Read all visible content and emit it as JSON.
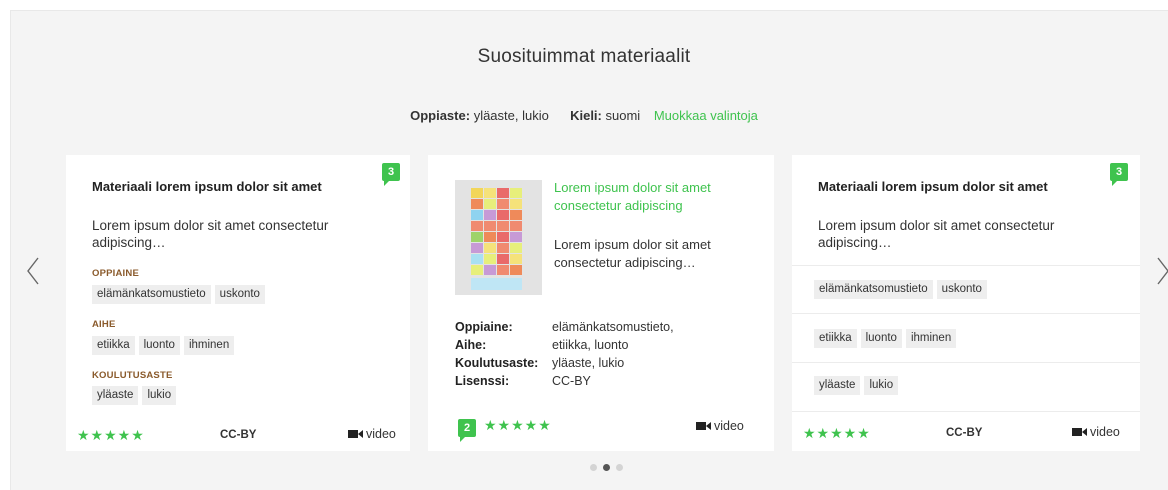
{
  "header": {
    "title": "Suosituimmat materiaalit"
  },
  "filters": {
    "level_label": "Oppiaste:",
    "level_value": "yläaste, lukio",
    "language_label": "Kieli:",
    "language_value": "suomi",
    "edit_link": "Muokkaa valintoja"
  },
  "cards": [
    {
      "badge": "3",
      "title": "Materiaali lorem ipsum dolor sit amet",
      "description": "Lorem ipsum dolor sit amet consectetur adipiscing…",
      "sections": [
        {
          "label": "OPPIAINE",
          "tags": [
            "elämänkatsomustieto",
            "uskonto"
          ]
        },
        {
          "label": "AIHE",
          "tags": [
            "etiikka",
            "luonto",
            "ihminen"
          ]
        },
        {
          "label": "KOULUTUSASTE",
          "tags": [
            "yläaste",
            "lukio"
          ]
        }
      ],
      "rating": 5,
      "stars": "★★★★★",
      "license": "CC-BY",
      "media": "video"
    },
    {
      "badge": "2",
      "title": "Lorem ipsum dolor sit amet consectetur adipiscing",
      "description": "Lorem ipsum dolor sit amet consectetur adipiscing…",
      "thumbnail_icon": "colorful-blocks-image",
      "meta": [
        {
          "key": "Oppiaine:",
          "value": "elämänkatsomustieto,"
        },
        {
          "key": "Aihe:",
          "value": "etiikka, luonto"
        },
        {
          "key": "Koulutusaste:",
          "value": "yläaste, lukio"
        },
        {
          "key": "Lisenssi:",
          "value": "CC-BY"
        }
      ],
      "rating": 5,
      "stars": "★★★★★",
      "media": "video"
    },
    {
      "badge": "3",
      "title": "Materiaali lorem ipsum dolor sit amet",
      "description": "Lorem ipsum dolor sit amet consectetur adipiscing…",
      "tag_groups": [
        [
          "elämänkatsomustieto",
          "uskonto"
        ],
        [
          "etiikka",
          "luonto",
          "ihminen"
        ],
        [
          "yläaste",
          "lukio"
        ]
      ],
      "rating": 5,
      "stars": "★★★★★",
      "license": "CC-BY",
      "media": "video"
    }
  ],
  "carousel": {
    "page_count": 3,
    "active_page": 2
  },
  "colors": {
    "accent": "#3fc34e",
    "section_label": "#8a5a2b",
    "background": "#f4f4f4"
  }
}
